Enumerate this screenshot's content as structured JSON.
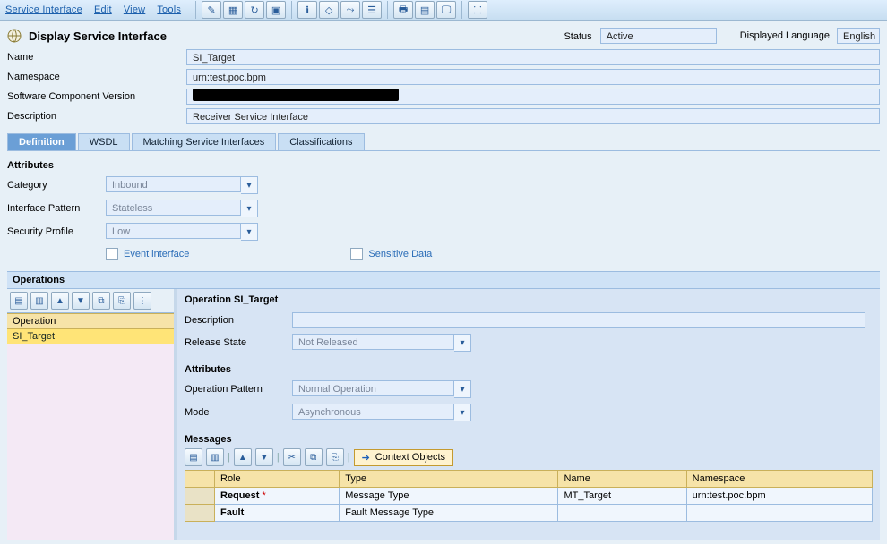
{
  "menu": {
    "service_interface": "Service Interface",
    "edit": "Edit",
    "view": "View",
    "tools": "Tools"
  },
  "header": {
    "title": "Display Service Interface",
    "status_label": "Status",
    "status_value": "Active",
    "displayed_language_label": "Displayed Language",
    "displayed_language_value": "English"
  },
  "fields": {
    "name_label": "Name",
    "name_value": "SI_Target",
    "namespace_label": "Namespace",
    "namespace_value": "urn:test.poc.bpm",
    "scv_label": "Software Component Version",
    "scv_value": "",
    "desc_label": "Description",
    "desc_value": "Receiver Service Interface"
  },
  "tabs": {
    "definition": "Definition",
    "wsdl": "WSDL",
    "matching": "Matching Service Interfaces",
    "classifications": "Classifications"
  },
  "attributes": {
    "title": "Attributes",
    "category_label": "Category",
    "category_value": "Inbound",
    "pattern_label": "Interface Pattern",
    "pattern_value": "Stateless",
    "security_label": "Security Profile",
    "security_value": "Low",
    "event_label": "Event interface",
    "sensitive_label": "Sensitive Data"
  },
  "operations": {
    "title": "Operations",
    "list_header": "Operation",
    "selected": "SI_Target"
  },
  "op_detail": {
    "title": "Operation SI_Target",
    "desc_label": "Description",
    "desc_value": "",
    "release_label": "Release State",
    "release_value": "Not Released",
    "attr_title": "Attributes",
    "op_pattern_label": "Operation Pattern",
    "op_pattern_value": "Normal Operation",
    "mode_label": "Mode",
    "mode_value": "Asynchronous"
  },
  "messages": {
    "title": "Messages",
    "context_objects": "Context Objects",
    "cols": {
      "role": "Role",
      "type": "Type",
      "name": "Name",
      "namespace": "Namespace"
    },
    "rows": [
      {
        "role": "Request",
        "star": "*",
        "type": "Message Type",
        "name": "MT_Target",
        "namespace": "urn:test.poc.bpm"
      },
      {
        "role": "Fault",
        "star": "",
        "type": "Fault Message Type",
        "name": "",
        "namespace": ""
      }
    ]
  }
}
